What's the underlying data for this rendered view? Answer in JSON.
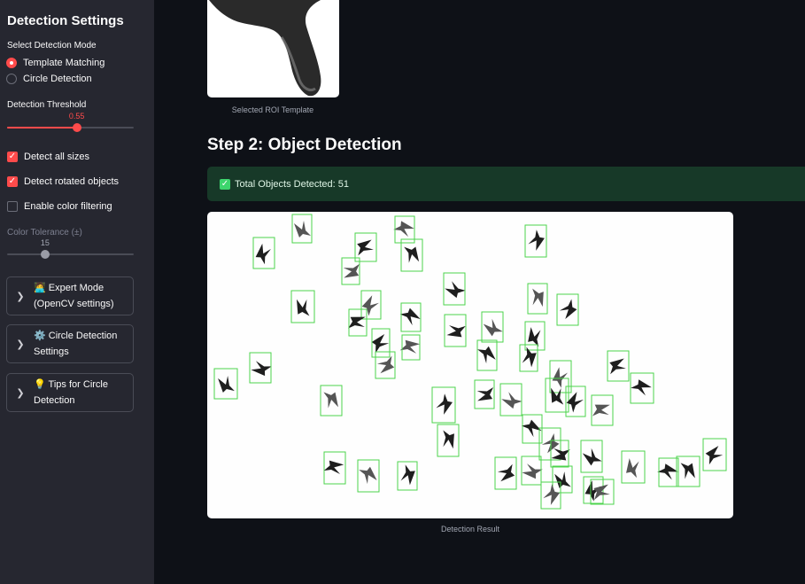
{
  "sidebar": {
    "title": "Detection Settings",
    "mode_label": "Select Detection Mode",
    "modes": [
      {
        "label": "Template Matching",
        "selected": true
      },
      {
        "label": "Circle Detection",
        "selected": false
      }
    ],
    "threshold": {
      "label": "Detection Threshold",
      "value": "0.55",
      "min": 0,
      "max": 1,
      "current": 0.55
    },
    "checks": [
      {
        "label": "Detect all sizes",
        "checked": true
      },
      {
        "label": "Detect rotated objects",
        "checked": true
      },
      {
        "label": "Enable color filtering",
        "checked": false
      }
    ],
    "tolerance": {
      "label": "Color Tolerance (±)",
      "value": "15",
      "min": 0,
      "max": 50,
      "current": 15
    },
    "expanders": [
      {
        "line1": "🧑‍💻 Expert Mode",
        "line2": "(OpenCV settings)"
      },
      {
        "line1": "⚙️ Circle Detection",
        "line2": "Settings"
      },
      {
        "line1": "💡 Tips for Circle",
        "line2": "Detection"
      }
    ]
  },
  "main": {
    "roi_caption": "Selected ROI Template",
    "step_title": "Step 2: Object Detection",
    "alert_text": "Total Objects Detected: 51",
    "result_caption": "Detection Result"
  },
  "colors": {
    "accent": "#ff4b4b",
    "sidebar_bg": "#262730",
    "app_bg": "#0e1117",
    "success_bg": "#173928",
    "box": "#4cd44c"
  },
  "icons": {
    "chevron": "chevron-right-icon",
    "check": "check-icon"
  }
}
